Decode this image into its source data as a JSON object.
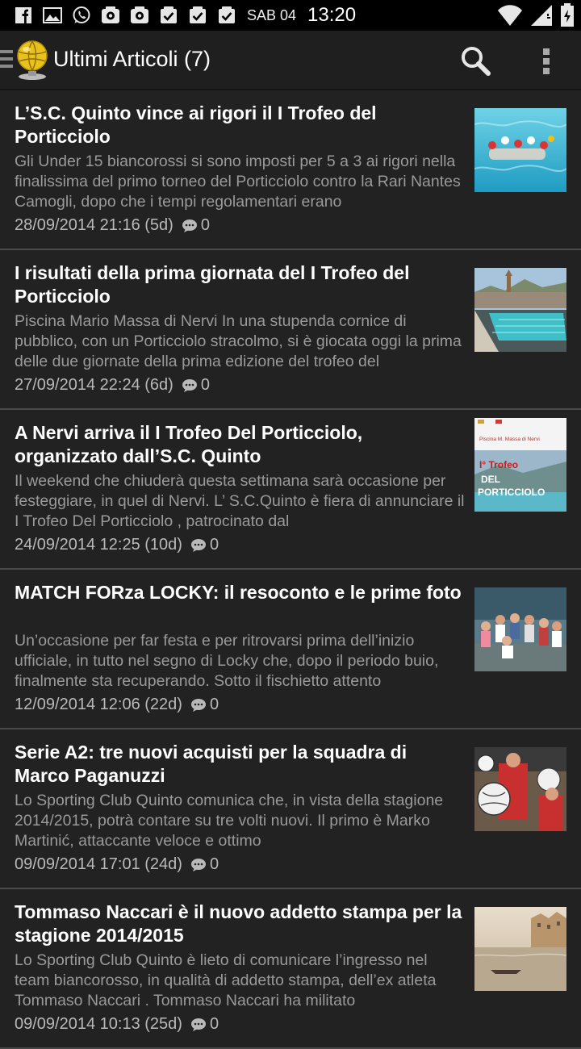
{
  "status_bar": {
    "date": "SAB 04",
    "time": "13:20",
    "notification_icons": [
      "facebook-icon",
      "gallery-icon",
      "whatsapp-icon",
      "mail-app-icon",
      "mail-app-icon-2",
      "check-box-icon",
      "check-box-icon-2",
      "check-box-icon-3"
    ]
  },
  "action_bar": {
    "title": "Ultimi Articoli (7)"
  },
  "colors": {
    "background": "#222222",
    "title_text": "#ffffff",
    "excerpt_text": "#9a9a9a",
    "divider": "#4a4a4a"
  },
  "articles": [
    {
      "title": "L’S.C. Quinto vince ai rigori il I Trofeo del Porticciolo",
      "excerpt": "Gli Under 15 biancorossi si sono imposti per 5 a 3 ai rigori nella finalissima del primo torneo del Porticciolo contro la Rari Nantes Camogli, dopo che i tempi regolamentari erano",
      "date": "28/09/2014 21:16 (5d)",
      "comments": "0"
    },
    {
      "title": "I risultati della prima giornata del I Trofeo del Porticciolo",
      "excerpt": "Piscina Mario Massa di Nervi In una stupenda cornice di pubblico, con un Porticciolo stracolmo, si è giocata oggi la prima delle due giornate della prima edizione del trofeo del",
      "date": "27/09/2014 22:24 (6d)",
      "comments": "0"
    },
    {
      "title": "A Nervi arriva il I Trofeo Del Porticciolo, organizzato dall’S.C. Quinto",
      "excerpt": "Il weekend che chiuderà questa settimana sarà occasione per festeggiare, in quel di Nervi. L’ S.C.Quinto è fiera di annunciare il I Trofeo Del Porticciolo , patrocinato dal",
      "date": "24/09/2014 12:25 (10d)",
      "comments": "0",
      "thumb_text": {
        "small": "Piscina M. Massa di Nervi",
        "line1": "I° Trofeo",
        "line2": "DEL",
        "line3": "PORTICCIOLO"
      }
    },
    {
      "title": "MATCH FORza LOCKY: il resoconto e le prime foto",
      "excerpt": "Un’occasione per far festa e per ritrovarsi prima dell’inizio ufficiale, in tutto nel segno di Locky che, dopo il periodo buio, finalmente sta recuperando. Sotto il fischietto attento",
      "date": "12/09/2014 12:06 (22d)",
      "comments": "0"
    },
    {
      "title": "Serie A2: tre nuovi acquisti per la squadra di Marco Paganuzzi",
      "excerpt": "Lo Sporting Club Quinto comunica che, in vista della stagione 2014/2015, potrà contare su tre volti nuovi. Il primo è  Marko Martinić,  attaccante veloce e ottimo",
      "date": "09/09/2014 17:01 (24d)",
      "comments": "0"
    },
    {
      "title": "Tommaso Naccari è il nuovo addetto stampa per la stagione 2014/2015",
      "excerpt": "Lo Sporting Club Quinto è lieto di comunicare l’ingresso nel team biancorosso, in qualità di addetto stampa, dell’ex atleta Tommaso Naccari . Tommaso Naccari ha militato",
      "date": "09/09/2014 10:13 (25d)",
      "comments": "0"
    }
  ]
}
